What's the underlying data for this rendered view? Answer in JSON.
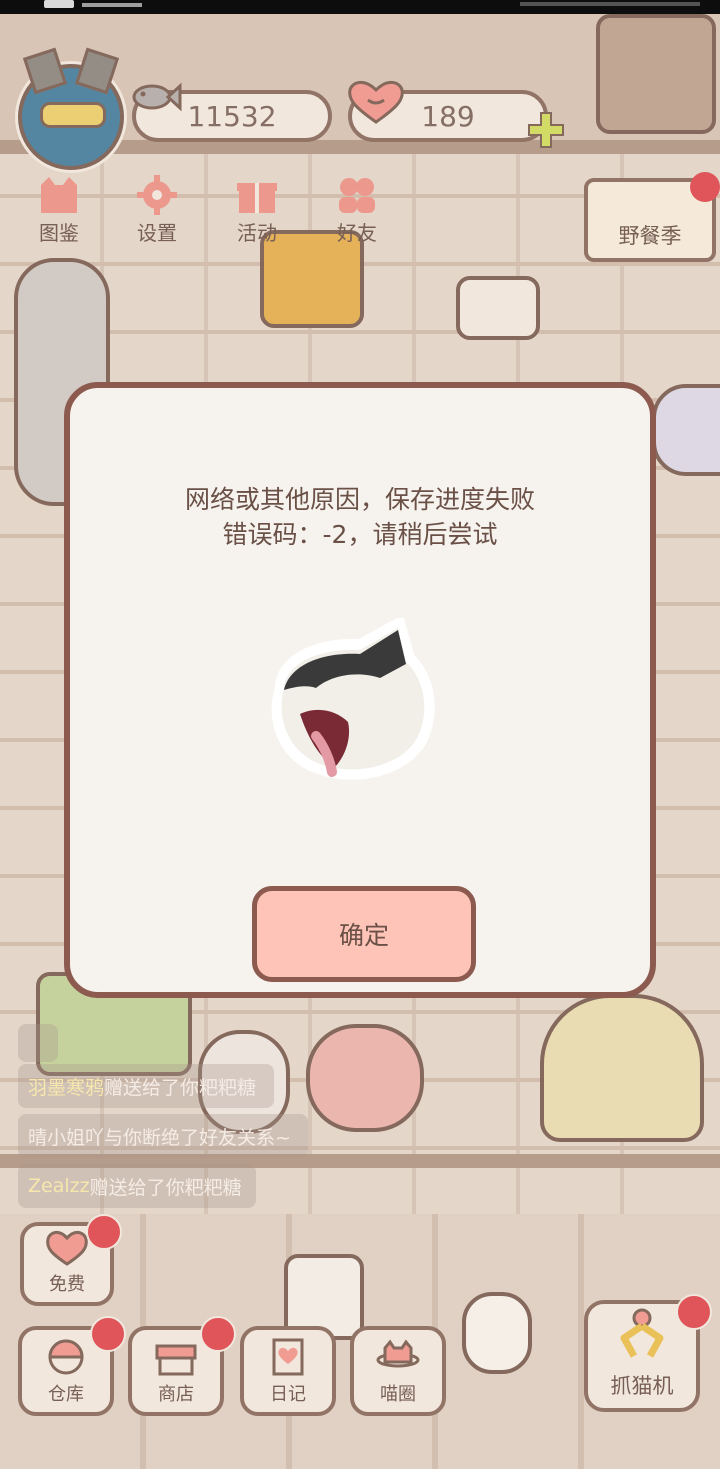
{
  "top_bar": {
    "fish_count": "11532",
    "heart_count": "189"
  },
  "top_nav": [
    {
      "label": "图鉴"
    },
    {
      "label": "设置"
    },
    {
      "label": "活动"
    },
    {
      "label": "好友"
    }
  ],
  "event": {
    "label": "野餐季"
  },
  "dialog": {
    "message_line1": "网络或其他原因，保存进度失败",
    "message_line2": "错误码：-2，请稍后尝试",
    "confirm_label": "确定"
  },
  "chat_feed": [
    {
      "user": "羽墨寒鸦",
      "text": "赠送给了你粑粑糖"
    },
    {
      "user": "",
      "text": "晴小姐吖与你断绝了好友关系~"
    },
    {
      "user": "Zealzz",
      "text": "赠送给了你粑粑糖"
    }
  ],
  "bottom_bar": {
    "free_label": "免费",
    "warehouse_label": "仓库",
    "shop_label": "商店",
    "diary_label": "日记",
    "meow_circle_label": "喵圈",
    "claw_machine_label": "抓猫机"
  },
  "colors": {
    "badge": "#d8343c",
    "confirm_button": "#ffc4b8",
    "frame_border": "#8c5a4e",
    "dialog_bg": "#f6f3ee"
  }
}
